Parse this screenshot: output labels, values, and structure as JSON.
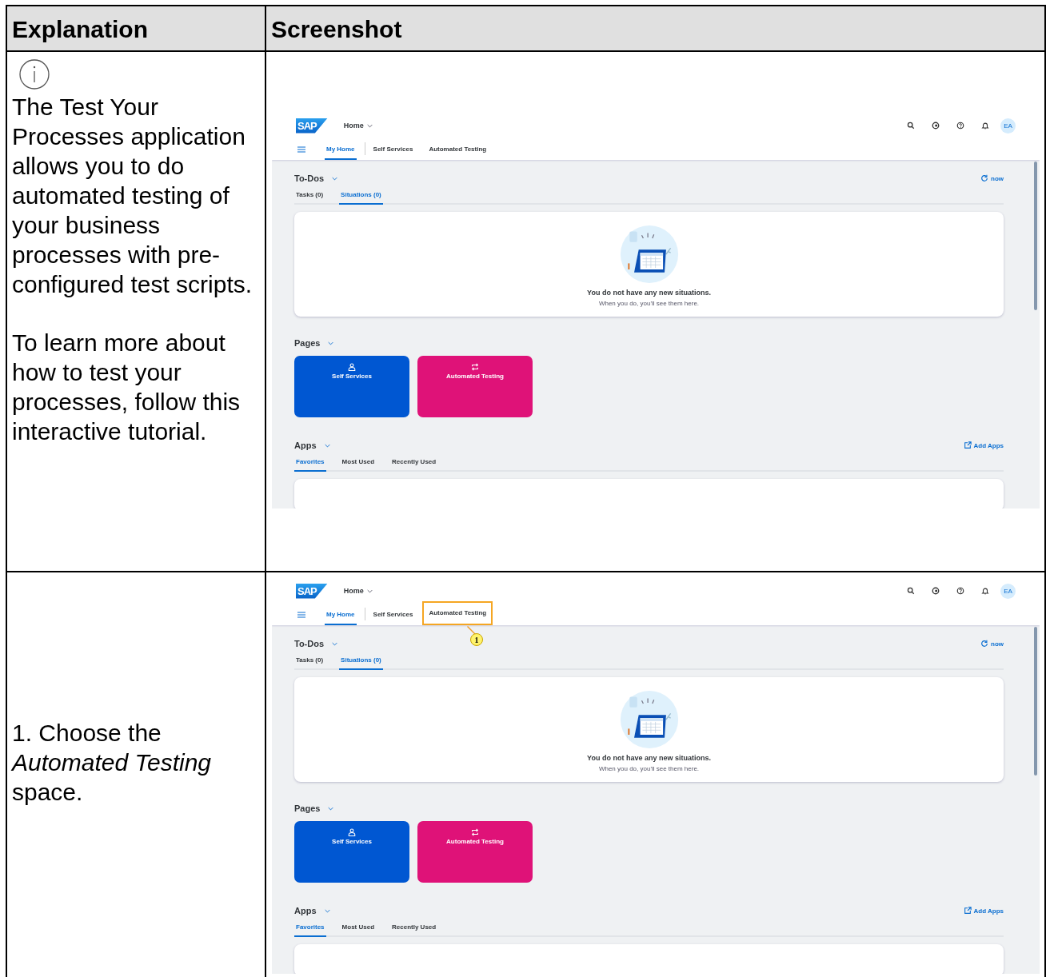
{
  "table": {
    "columns": [
      "Explanation",
      "Screenshot"
    ],
    "rows": [
      {
        "info": true,
        "paragraphs": [
          "The Test Your Processes application allows you to do automated testing of your business processes with pre-configured test scripts.",
          "To learn more about how to test your processes, follow this interactive tutorial."
        ],
        "screenshot": {
          "logo": "SAP",
          "home_menu": "Home",
          "nav_tabs": [
            {
              "label": "My Home",
              "selected": true,
              "highlighted": false
            },
            {
              "label": "Self Services",
              "selected": false,
              "highlighted": false
            },
            {
              "label": "Automated Testing",
              "selected": false,
              "highlighted": false
            }
          ],
          "avatar": "EA",
          "todos": {
            "title": "To-Dos",
            "refresh": "now",
            "tabs": [
              {
                "label": "Tasks (0)",
                "selected": false
              },
              {
                "label": "Situations (0)",
                "selected": true
              }
            ],
            "empty_title": "You do not have any new situations.",
            "empty_text": "When you do, you'll see them here."
          },
          "pages": {
            "title": "Pages",
            "tiles": [
              {
                "label": "Self Services",
                "kind": "person",
                "color": "#0057d2"
              },
              {
                "label": "Automated Testing",
                "kind": "sync",
                "color": "#df1278"
              }
            ]
          },
          "apps": {
            "title": "Apps",
            "add": "Add Apps",
            "tabs": [
              {
                "label": "Favorites",
                "selected": true
              },
              {
                "label": "Most Used",
                "selected": false
              },
              {
                "label": "Recently Used",
                "selected": false
              }
            ]
          }
        }
      },
      {
        "info": false,
        "paragraphs": [
          "1. Choose the *Automated Testing* space."
        ],
        "screenshot": {
          "logo": "SAP",
          "home_menu": "Home",
          "nav_tabs": [
            {
              "label": "My Home",
              "selected": true,
              "highlighted": false
            },
            {
              "label": "Self Services",
              "selected": false,
              "highlighted": false
            },
            {
              "label": "Automated Testing",
              "selected": false,
              "highlighted": true
            }
          ],
          "avatar": "EA",
          "callout": "1",
          "todos": {
            "title": "To-Dos",
            "refresh": "now",
            "tabs": [
              {
                "label": "Tasks (0)",
                "selected": false
              },
              {
                "label": "Situations (0)",
                "selected": true
              }
            ],
            "empty_title": "You do not have any new situations.",
            "empty_text": "When you do, you'll see them here."
          },
          "pages": {
            "title": "Pages",
            "tiles": [
              {
                "label": "Self Services",
                "kind": "person",
                "color": "#0057d2"
              },
              {
                "label": "Automated Testing",
                "kind": "sync",
                "color": "#df1278"
              }
            ]
          },
          "apps": {
            "title": "Apps",
            "add": "Add Apps",
            "tabs": [
              {
                "label": "Favorites",
                "selected": true
              },
              {
                "label": "Most Used",
                "selected": false
              },
              {
                "label": "Recently Used",
                "selected": false
              }
            ]
          }
        }
      }
    ]
  }
}
